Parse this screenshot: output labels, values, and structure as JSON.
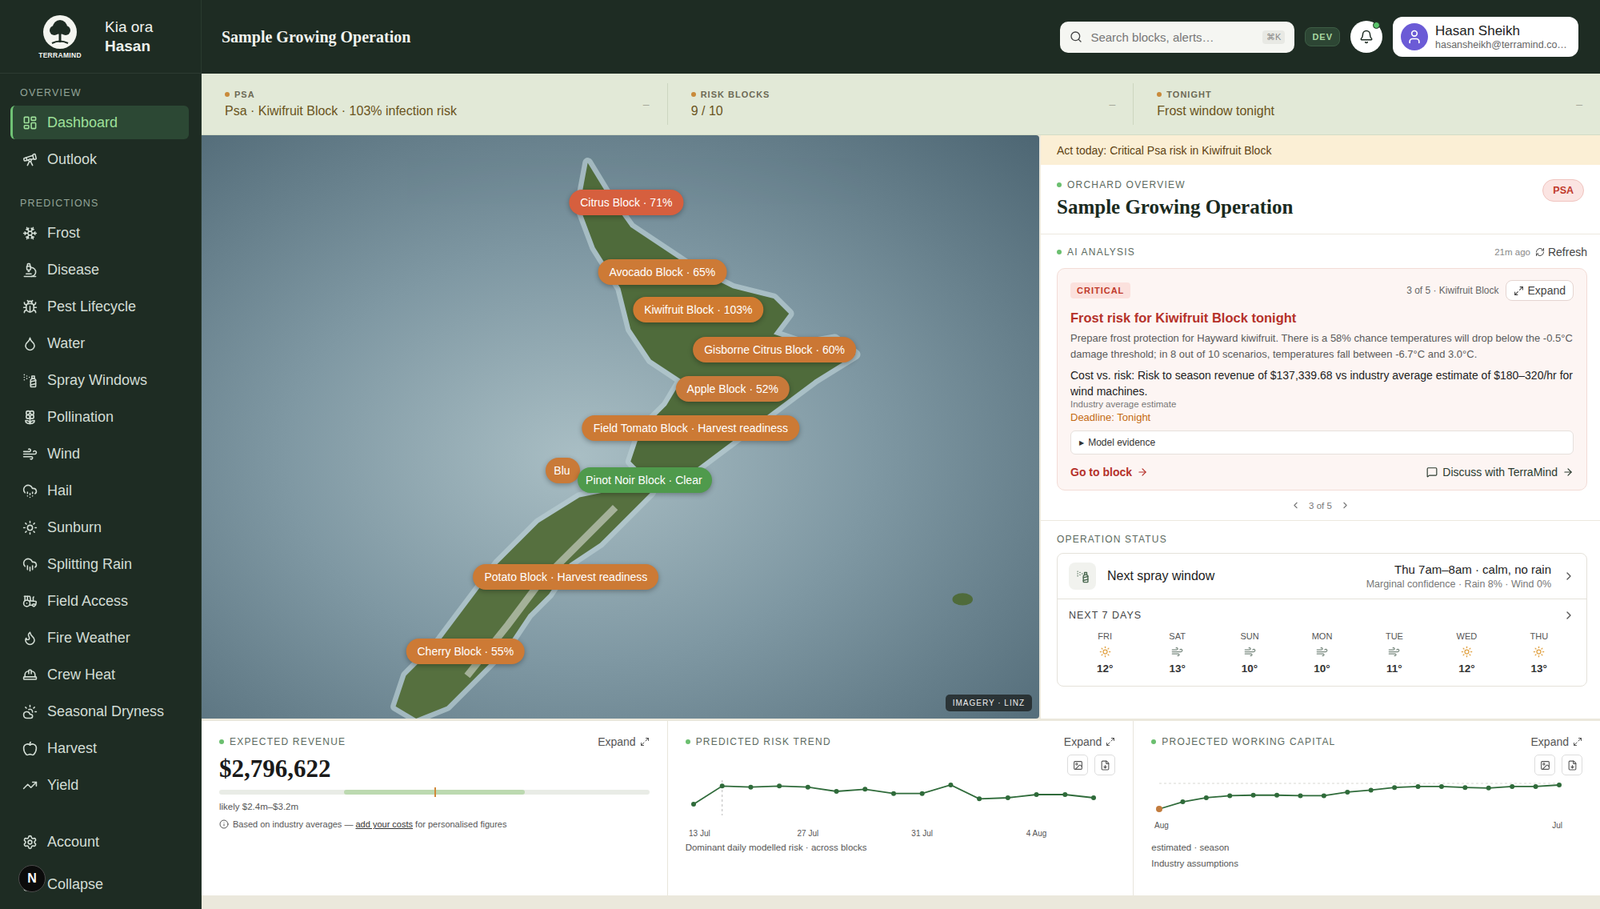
{
  "sidebar": {
    "logo_text": "TERRAMIND",
    "greeting": "Kia ora",
    "user": "Hasan",
    "sections": [
      {
        "title": "OVERVIEW",
        "items": [
          {
            "label": "Dashboard",
            "selected": true
          },
          {
            "label": "Outlook",
            "selected": false
          }
        ]
      },
      {
        "title": "PREDICTIONS",
        "items": [
          {
            "label": "Frost",
            "selected": false
          },
          {
            "label": "Disease",
            "selected": false
          },
          {
            "label": "Pest Lifecycle",
            "selected": false
          },
          {
            "label": "Water",
            "selected": false
          },
          {
            "label": "Spray Windows",
            "selected": false
          },
          {
            "label": "Pollination",
            "selected": false
          },
          {
            "label": "Wind",
            "selected": false
          },
          {
            "label": "Hail",
            "selected": false
          },
          {
            "label": "Sunburn",
            "selected": false
          },
          {
            "label": "Splitting Rain",
            "selected": false
          },
          {
            "label": "Field Access",
            "selected": false
          },
          {
            "label": "Fire Weather",
            "selected": false
          },
          {
            "label": "Crew Heat",
            "selected": false
          },
          {
            "label": "Seasonal Dryness",
            "selected": false
          },
          {
            "label": "Harvest",
            "selected": false
          },
          {
            "label": "Yield",
            "selected": false
          }
        ]
      }
    ],
    "footer": [
      {
        "label": "Account"
      },
      {
        "label": "Collapse"
      }
    ],
    "dev_indicator": "N"
  },
  "header": {
    "title": "Sample Growing Operation",
    "search": {
      "placeholder": "Search blocks, alerts…",
      "shortcut": "⌘K"
    },
    "env_badge": "DEV",
    "notifications": {
      "unread": true
    },
    "user": {
      "name": "Hasan Sheikh",
      "email": "hasansheikh@terramind.co…"
    }
  },
  "alert_strip": [
    {
      "label": "PSA",
      "value": "Psa · Kiwifruit Block · 103% infection risk",
      "toggle": "–"
    },
    {
      "label": "RISK BLOCKS",
      "value": "9 / 10",
      "toggle": "–"
    },
    {
      "label": "TONIGHT",
      "value": "Frost window tonight",
      "toggle": "–"
    }
  ],
  "map": {
    "attribution": "IMAGERY · LINZ",
    "pins": [
      {
        "label": "Citrus Block · 71%",
        "color": "#d65f3e"
      },
      {
        "label": "Avocado Block · 65%",
        "color": "#cd7a36"
      },
      {
        "label": "Kiwifruit Block · 103%",
        "color": "#d07b31"
      },
      {
        "label": "Gisborne Citrus Block · 60%",
        "color": "#cb7734"
      },
      {
        "label": "Apple Block · 52%",
        "color": "#c8793a"
      },
      {
        "label": "Field Tomato Block · Harvest readiness",
        "color": "#cc7a35"
      },
      {
        "label": "Blu",
        "color": "#c97a38"
      },
      {
        "label": "Pinot Noir Block · Clear",
        "color": "#4f9a4c"
      },
      {
        "label": "Potato Block · Harvest readiness",
        "color": "#cc7a35"
      },
      {
        "label": "Cherry Block · 55%",
        "color": "#cd7a35"
      }
    ]
  },
  "panel": {
    "banner": "Act today: Critical Psa risk in Kiwifruit Block",
    "overview_label": "ORCHARD OVERVIEW",
    "title": "Sample Growing Operation",
    "badge": "PSA",
    "analysis": {
      "label": "AI ANALYSIS",
      "updated": "21m ago",
      "refresh": "Refresh",
      "card": {
        "severity": "CRITICAL",
        "position": "3 of 5 · Kiwifruit Block",
        "expand": "Expand",
        "title": "Frost risk for Kiwifruit Block tonight",
        "body": "Prepare frost protection for Hayward kiwifruit. There is a 58% chance temperatures will drop below the -0.5°C damage threshold; in 8 out of 10 scenarios, temperatures fall between -6.7°C and 3.0°C.",
        "cost": "Cost vs. risk: Risk to season revenue of $137,339.68 vs industry average estimate of $180–320/hr for wind machines.",
        "cost_note": "Industry average estimate",
        "deadline": "Deadline: Tonight",
        "evidence": {
          "toggle": "▶",
          "label": "Model evidence",
          "expanded": false
        },
        "go": "Go to block",
        "discuss": "Discuss with TerraMind"
      },
      "pager": "3 of 5"
    },
    "operations": {
      "label": "OPERATION STATUS",
      "spray": {
        "title": "Next spray window",
        "when": "Thu 7am–8am · calm, no rain",
        "detail": "Marginal confidence · Rain 8% · Wind 0%"
      },
      "forecast": {
        "label": "NEXT 7 DAYS",
        "days": [
          {
            "day": "FRI",
            "temp": "12°",
            "kind": "sun"
          },
          {
            "day": "SAT",
            "temp": "13°",
            "kind": "wind"
          },
          {
            "day": "SUN",
            "temp": "10°",
            "kind": "wind"
          },
          {
            "day": "MON",
            "temp": "10°",
            "kind": "wind"
          },
          {
            "day": "TUE",
            "temp": "11°",
            "kind": "wind"
          },
          {
            "day": "WED",
            "temp": "12°",
            "kind": "sun"
          },
          {
            "day": "THU",
            "temp": "13°",
            "kind": "sun"
          }
        ]
      }
    }
  },
  "bottom": {
    "revenue": {
      "label": "EXPECTED REVENUE",
      "expand": "Expand",
      "value": "$2,796,622",
      "range": {
        "low": 0.29,
        "high": 0.71,
        "marker": 0.5
      },
      "range_text": "likely $2.4m–$3.2m",
      "note": "Based on industry averages — ",
      "note_link": "add your costs",
      "note_end": " for personalised figures"
    },
    "risk_trend": {
      "label": "PREDICTED RISK TREND",
      "expand": "Expand",
      "values": [
        58,
        75,
        74,
        75,
        74,
        70,
        72,
        68,
        68,
        76,
        63,
        64,
        67,
        67,
        64
      ],
      "marker_index": 1,
      "ticks": [
        {
          "label": "13 Jul",
          "at": 0
        },
        {
          "label": "27 Jul",
          "at": 4
        },
        {
          "label": "31 Jul",
          "at": 8
        },
        {
          "label": "4 Aug",
          "at": 12
        }
      ],
      "caption": "Dominant daily modelled risk · across blocks"
    },
    "working_capital": {
      "label": "PROJECTED WORKING CAPITAL",
      "expand": "Expand",
      "values": [
        0.9,
        1.6,
        2.0,
        2.2,
        2.25,
        2.25,
        2.2,
        2.2,
        2.55,
        2.75,
        3.0,
        3.1,
        3.1,
        3.0,
        2.95,
        3.1,
        3.1,
        3.25
      ],
      "ticks": [
        {
          "label": "Aug",
          "at": 0
        },
        {
          "label": "Jul",
          "at": 17
        }
      ],
      "captions": [
        "estimated · season",
        "Industry assumptions"
      ]
    }
  }
}
